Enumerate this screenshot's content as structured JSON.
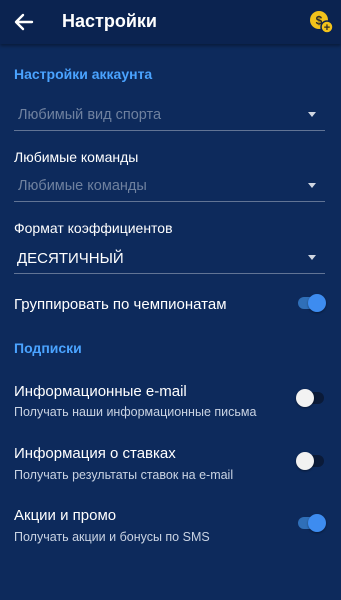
{
  "header": {
    "title": "Настройки",
    "back_icon": "arrow-left-icon",
    "coin_icon": "coin-add-icon",
    "coin_symbol": "$",
    "coin_plus": "+"
  },
  "account": {
    "section_title": "Настройки аккаунта",
    "sport_select": {
      "value": "Любимый вид спорта"
    },
    "teams_label": "Любимые команды",
    "teams_select": {
      "value": "Любимые команды"
    },
    "odds_label": "Формат коэффициентов",
    "odds_select": {
      "value": "ДЕСЯТИЧНЫЙ"
    },
    "group_label": "Группировать по чемпионатам",
    "group_toggle": true
  },
  "subscriptions": {
    "section_title": "Подписки",
    "items": [
      {
        "title": "Информационные e-mail",
        "subtitle": "Получать наши информационные письма",
        "enabled": false
      },
      {
        "title": "Информация о ставках",
        "subtitle": "Получать результаты ставок на e-mail",
        "enabled": false
      },
      {
        "title": "Акции и промо",
        "subtitle": "Получать акции и бонусы по SMS",
        "enabled": true
      }
    ]
  },
  "colors": {
    "background": "#0d2a5c",
    "appbar": "#0b2350",
    "accent": "#4aa3ff",
    "toggle_on": "#3d8cf0",
    "coin": "#f2c21b"
  }
}
